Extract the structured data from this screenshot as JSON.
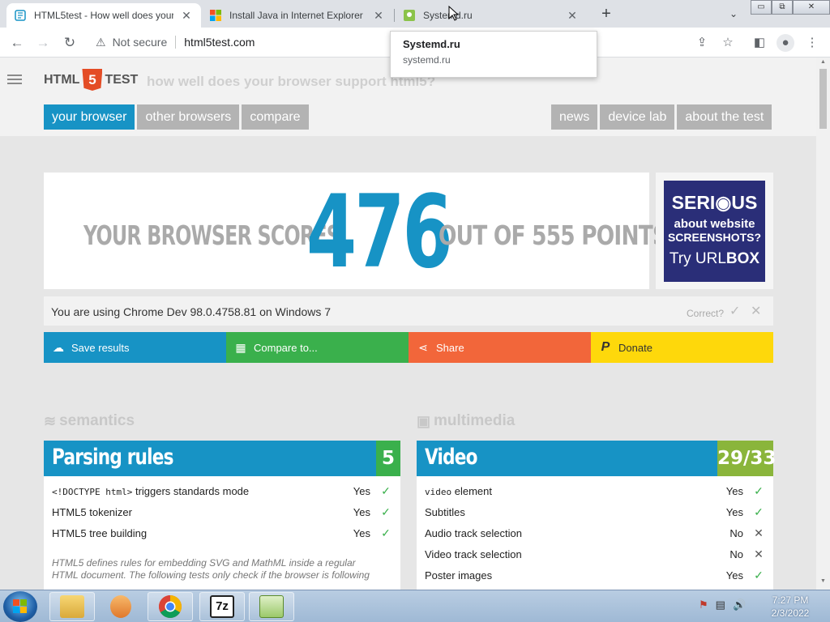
{
  "browser": {
    "tabs": [
      {
        "title": "HTML5test - How well does your",
        "close": "✕"
      },
      {
        "title": "Install Java in Internet Explorer",
        "close": "✕"
      },
      {
        "title": "Systemd.ru",
        "close": "✕"
      }
    ],
    "new_tab": "+",
    "tab_search": "⌄",
    "window_buttons": {
      "minimize": "▭",
      "restore": "⧉",
      "close": "✕"
    },
    "nav": {
      "back": "←",
      "forward": "→",
      "reload": "↻"
    },
    "omnibox": {
      "security_icon": "⚠",
      "security_text": "Not secure",
      "url": "html5test.com"
    },
    "toolbar_icons": {
      "share": "⇪",
      "bookmark": "☆",
      "sidebar": "◧",
      "profile": "●",
      "menu": "⋮"
    },
    "tooltip": {
      "title": "Systemd.ru",
      "url": "systemd.ru"
    }
  },
  "site": {
    "logo_left": "HTML",
    "logo_5": "5",
    "logo_right": "TEST",
    "tagline": "how well does your browser support html5?",
    "nav_left": [
      "your browser",
      "other browsers",
      "compare"
    ],
    "nav_right": [
      "news",
      "device lab",
      "about the test"
    ],
    "score": {
      "prefix": "YOUR BROWSER SCORES",
      "value": "476",
      "suffix": "OUT OF 555 POINTS"
    },
    "ad": {
      "line1": "SERI◉US",
      "line2": "about website",
      "line3": "SCREENSHOTS?",
      "line4_a": "Try URL",
      "line4_b": "BOX"
    },
    "user_agent": {
      "text": "You are using Chrome Dev 98.0.4758.81 on Windows 7",
      "correct": "Correct?",
      "yes": "✓",
      "no": "✕"
    },
    "actions": [
      {
        "label": "Save results",
        "icon": "☁"
      },
      {
        "label": "Compare to...",
        "icon": "▦"
      },
      {
        "label": "Share",
        "icon": "⋖"
      },
      {
        "label": "Donate",
        "icon": "P"
      }
    ],
    "sections": {
      "semantics": {
        "title": "semantics",
        "icon": "≋"
      },
      "multimedia": {
        "title": "multimedia",
        "icon": "▣"
      }
    },
    "parsing": {
      "name": "Parsing rules",
      "points": "5",
      "rows": [
        {
          "label_code": "<!DOCTYPE html>",
          "label": " triggers standards mode",
          "value": "Yes",
          "mark": "✓"
        },
        {
          "label": "HTML5 tokenizer",
          "value": "Yes",
          "mark": "✓"
        },
        {
          "label": "HTML5 tree building",
          "value": "Yes",
          "mark": "✓"
        }
      ],
      "description": "HTML5 defines rules for embedding SVG and MathML inside a regular HTML document. The following tests only check if the browser is following"
    },
    "video": {
      "name": "Video",
      "points": "29/33",
      "rows": [
        {
          "label_code": "video",
          "label": " element",
          "value": "Yes",
          "mark": "✓"
        },
        {
          "label": "Subtitles",
          "value": "Yes",
          "mark": "✓"
        },
        {
          "label": "Audio track selection",
          "value": "No",
          "mark": "✕"
        },
        {
          "label": "Video track selection",
          "value": "No",
          "mark": "✕"
        },
        {
          "label": "Poster images",
          "value": "Yes",
          "mark": "✓"
        }
      ]
    }
  },
  "taskbar": {
    "time": "7:27 PM",
    "date": "2/3/2022",
    "tray_icons": [
      "⚑",
      "▤",
      "🔊"
    ],
    "sevenzip": "7z"
  },
  "colors": {
    "blue": "#1793c5",
    "green": "#3ab04c",
    "orange": "#f2663a",
    "yellow": "#fed80b",
    "olive": "#8ab53b"
  }
}
